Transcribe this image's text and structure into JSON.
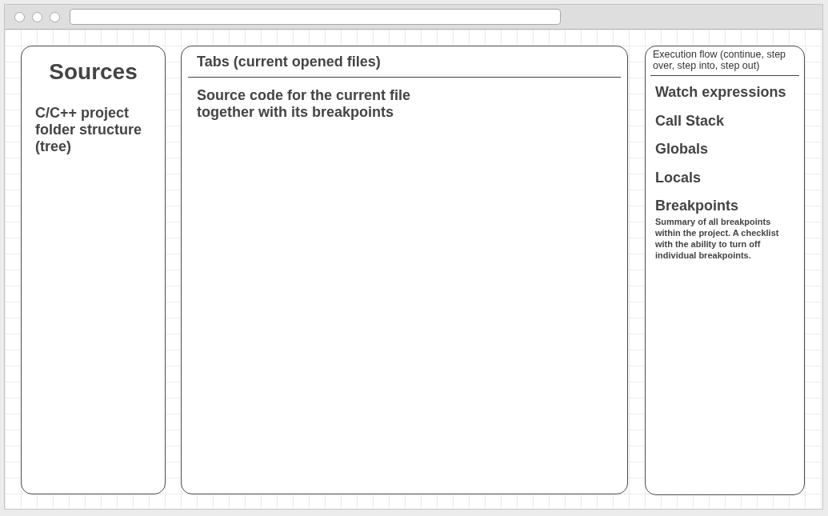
{
  "sources_panel": {
    "title": "Sources",
    "description": "C/C++ project folder structure (tree)"
  },
  "editor_panel": {
    "tabs_label": "Tabs (current opened files)",
    "body": "Source code for the current file together with its breakpoints"
  },
  "debug_panel": {
    "execution_flow": "Execution flow (continue, step over, step into, step out)",
    "sections": [
      {
        "title": "Watch expressions"
      },
      {
        "title": "Call Stack"
      },
      {
        "title": "Globals"
      },
      {
        "title": "Locals"
      },
      {
        "title": "Breakpoints",
        "description": "Summary of all breakpoints within the project. A checklist with the ability to turn off individual breakpoints."
      }
    ]
  }
}
